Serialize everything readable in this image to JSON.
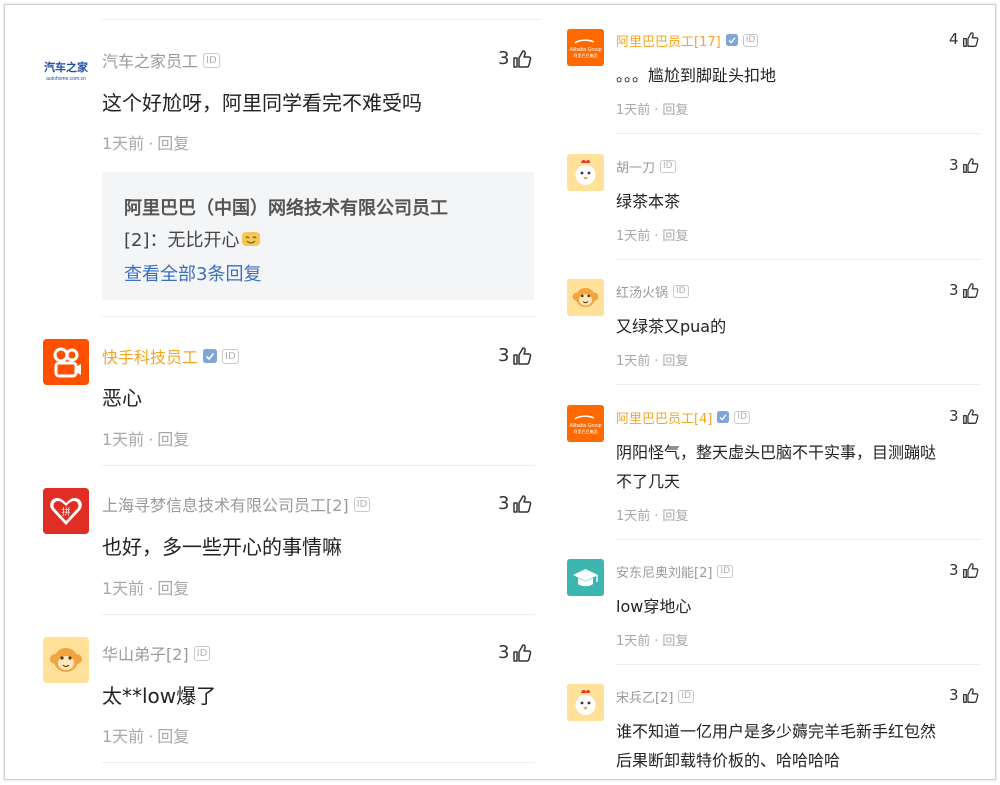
{
  "left_comments": [
    {
      "avatar": "autohome-logo",
      "name": "汽车之家员工",
      "likes": "3",
      "text": "这个好尬呀，阿里同学看完不难受吗",
      "time": "1天前",
      "reply": "回复",
      "sub_reply": {
        "name": "阿里巴巴（中国）网络技术有限公司员工",
        "line2_prefix": "[2]：无比开心",
        "view_all": "查看全部3条回复"
      }
    },
    {
      "avatar": "kuaishou-logo",
      "name": "快手科技员工",
      "likes": "3",
      "text": "恶心",
      "time": "1天前",
      "reply": "回复"
    },
    {
      "avatar": "pinduoduo-logo",
      "name": "上海寻梦信息技术有限公司员工[2]",
      "likes": "3",
      "text": "也好，多一些开心的事情嘛",
      "time": "1天前",
      "reply": "回复"
    },
    {
      "avatar": "monkey-avatar",
      "name": "华山弟子[2]",
      "likes": "3",
      "text": "太**low爆了",
      "time": "1天前",
      "reply": "回复"
    }
  ],
  "right_comments": [
    {
      "avatar": "alibaba-logo",
      "name": "阿里巴巴员工[17]",
      "likes": "4",
      "text": "。。。尴尬到脚趾头扣地",
      "time": "1天前",
      "reply": "回复"
    },
    {
      "avatar": "chicken-avatar",
      "name": "胡一刀",
      "likes": "3",
      "text": "绿茶本茶",
      "time": "1天前",
      "reply": "回复"
    },
    {
      "avatar": "monkey-avatar",
      "name": "红汤火锅",
      "likes": "3",
      "text": "又绿茶又pua的",
      "time": "1天前",
      "reply": "回复"
    },
    {
      "avatar": "alibaba-logo",
      "name": "阿里巴巴员工[4]",
      "likes": "3",
      "text_lines": [
        "阴阳怪气，整天虚头巴脑不干实事，目测蹦哒",
        "不了几天"
      ],
      "time": "1天前",
      "reply": "回复"
    },
    {
      "avatar": "graduation-cap-avatar",
      "name": "安东尼奥刘能[2]",
      "likes": "3",
      "text": "low穿地心",
      "time": "1天前",
      "reply": "回复"
    },
    {
      "avatar": "chicken-avatar",
      "name": "宋兵乙[2]",
      "likes": "3",
      "text_lines": [
        "谁不知道一亿用户是多少薅完羊毛新手红包然",
        "后果断卸载特价板的、哈哈哈哈"
      ]
    }
  ],
  "labels": {
    "id_badge": "ID",
    "autohome_logo_text": "汽车之家",
    "autohome_logo_sub": "autohome.com.cn",
    "alibaba_logo_text": "Alibaba Group",
    "alibaba_logo_sub": "阿里巴巴集团",
    "pdd_logo_text": "拼"
  },
  "colors": {
    "orange_name": "#f5a623",
    "gray_name": "#9a9a9a",
    "link_blue": "#3a6fc4",
    "reply_box_bg": "#f4f5f7",
    "alibaba_orange": "#ff6a00",
    "kuaishou_orange": "#ff5000",
    "pinduoduo_red": "#e02e24"
  }
}
